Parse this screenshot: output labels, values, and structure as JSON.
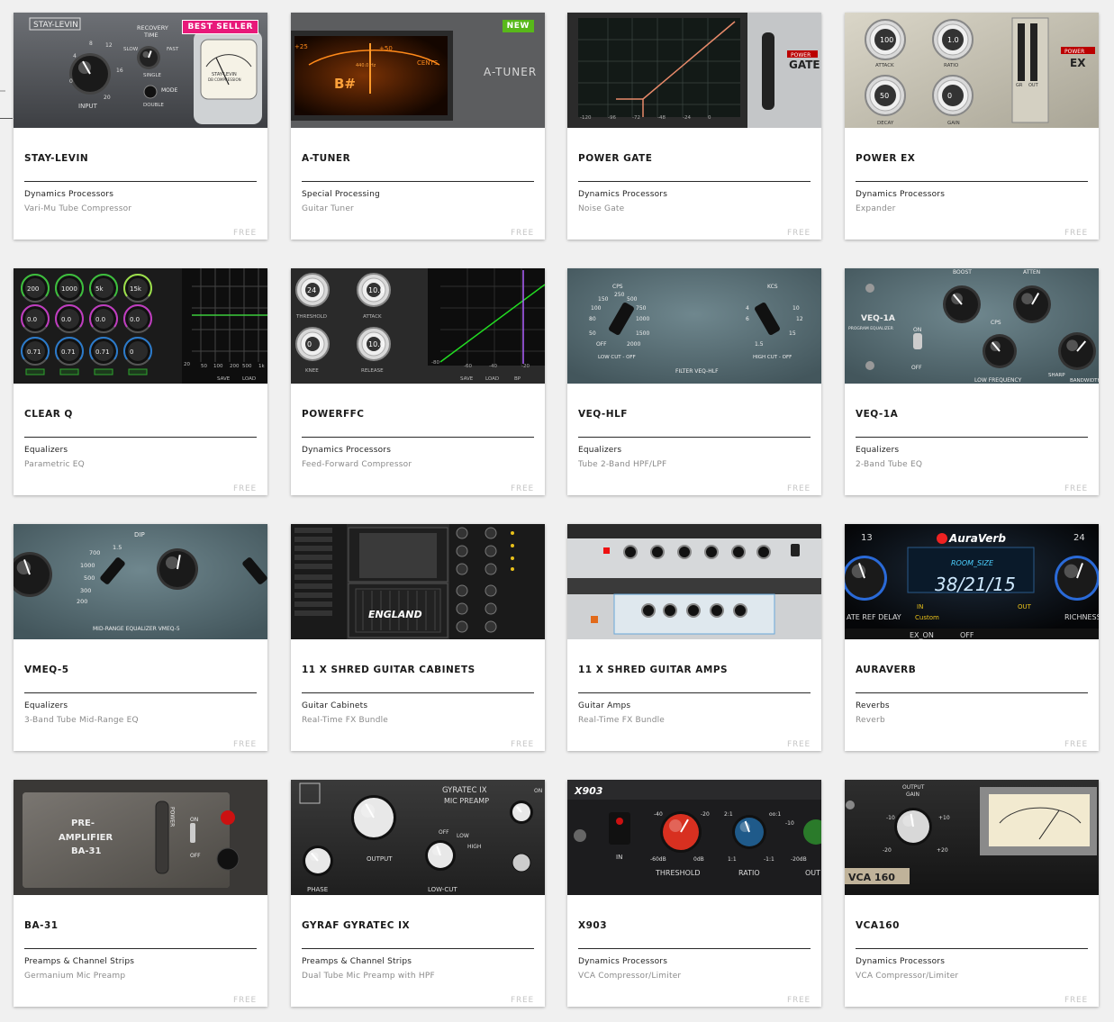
{
  "colors": {
    "best_seller": "#e8197a",
    "new": "#58b81a",
    "title": "#1a1a1a",
    "category": "#222222",
    "subtitle": "#8a8a8a",
    "price": "#c6c6c6"
  },
  "products": [
    {
      "title": "STAY-LEVIN",
      "category": "Dynamics Processors",
      "subtitle": "Vari-Mu Tube Compressor",
      "price": "FREE",
      "badge": "BEST SELLER",
      "thumb_text": [
        "STAY-LEVIN",
        "RECOVERY",
        "TIME",
        "SLOW",
        "FAST",
        "SINGLE",
        "MODE",
        "DOUBLE",
        "INPUT",
        "STAY-LEVIN",
        "DB COMPRESSION",
        "0",
        "4",
        "8",
        "12",
        "16",
        "20"
      ]
    },
    {
      "title": "A-TUNER",
      "category": "Special Processing",
      "subtitle": "Guitar Tuner",
      "price": "FREE",
      "badge": "NEW",
      "thumb_text": [
        "A-TUNER",
        "B#",
        "440.0 Hz",
        "25",
        "+25",
        "+50",
        "CENTS"
      ]
    },
    {
      "title": "POWER GATE",
      "category": "Dynamics Processors",
      "subtitle": "Noise Gate",
      "price": "FREE",
      "badge": "",
      "thumb_text": [
        "POWER",
        "GATE",
        "-120",
        "-96",
        "-72",
        "-48",
        "-24",
        "0"
      ]
    },
    {
      "title": "POWER EX",
      "category": "Dynamics Processors",
      "subtitle": "Expander",
      "price": "FREE",
      "badge": "",
      "thumb_text": [
        "100",
        "1.0",
        "50",
        "0",
        "ATTACK",
        "RATIO",
        "DECAY",
        "GAIN",
        "GR",
        "OUT",
        "POWER",
        "EX"
      ]
    },
    {
      "title": "CLEAR Q",
      "category": "Equalizers",
      "subtitle": "Parametric EQ",
      "price": "FREE",
      "badge": "",
      "thumb_text": [
        "200",
        "1000",
        "5k",
        "15k",
        "0.0",
        "0.0",
        "0.0",
        "0.0",
        "0.71",
        "0.71",
        "0.71",
        "0",
        "20",
        "50",
        "100",
        "200",
        "500",
        "1k",
        "SAVE",
        "LOAD"
      ]
    },
    {
      "title": "POWERFFC",
      "category": "Dynamics Processors",
      "subtitle": "Feed-Forward Compressor",
      "price": "FREE",
      "badge": "",
      "thumb_text": [
        "24",
        "10.0",
        "0",
        "10.0",
        "THRESHOLD",
        "ATTACK",
        "KNEE",
        "RELEASE",
        "-80",
        "-60",
        "-40",
        "-20",
        "SAVE",
        "LOAD",
        "BP"
      ]
    },
    {
      "title": "VEQ-HLF",
      "category": "Equalizers",
      "subtitle": "Tube 2-Band HPF/LPF",
      "price": "FREE",
      "badge": "",
      "thumb_text": [
        "CPS",
        "250",
        "500",
        "750",
        "1000",
        "1500",
        "2000",
        "150",
        "100",
        "80",
        "50",
        "OFF",
        "LOW CUT - OFF",
        "KCS",
        "4",
        "6",
        "8",
        "10",
        "12",
        "15",
        "1.5",
        "HIGH CUT - OFF",
        "FILTER VEQ-HLF"
      ]
    },
    {
      "title": "VEQ-1A",
      "category": "Equalizers",
      "subtitle": "2-Band Tube EQ",
      "price": "FREE",
      "badge": "",
      "thumb_text": [
        "VEQ-1A",
        "PROGRAM EQUALIZER",
        "ON",
        "OFF",
        "BOOST",
        "ATTEN",
        "CPS",
        "LOW FREQUENCY",
        "SHARP",
        "BANDWIDTH"
      ]
    },
    {
      "title": "VMEQ-5",
      "category": "Equalizers",
      "subtitle": "3-Band Tube Mid-Range EQ",
      "price": "FREE",
      "badge": "",
      "thumb_text": [
        "DIP",
        "700",
        "1.5",
        "1000",
        "500",
        "300",
        "200",
        "MID-RANGE EQUALIZER VMEQ-5"
      ]
    },
    {
      "title": "11 X SHRED GUITAR CABINETS",
      "category": "Guitar Cabinets",
      "subtitle": "Real-Time FX Bundle",
      "price": "FREE",
      "badge": "",
      "thumb_text": [
        "ENGLAND"
      ]
    },
    {
      "title": "11 X SHRED GUITAR AMPS",
      "category": "Guitar Amps",
      "subtitle": "Real-Time FX Bundle",
      "price": "FREE",
      "badge": "",
      "thumb_text": []
    },
    {
      "title": "AURAVERB",
      "category": "Reverbs",
      "subtitle": "Reverb",
      "price": "FREE",
      "badge": "",
      "thumb_text": [
        "AuraVerb",
        "ROOM_SIZE",
        "38/21/15",
        "IN",
        "OUT",
        "Custom",
        "ATE REF DELAY",
        "RICHNESS",
        "EX_ON",
        "OFF",
        "13",
        "24"
      ]
    },
    {
      "title": "BA-31",
      "category": "Preamps & Channel Strips",
      "subtitle": "Germanium Mic Preamp",
      "price": "FREE",
      "badge": "",
      "thumb_text": [
        "PRE-",
        "AMPLIFIER",
        "BA-31",
        "POWER",
        "ON",
        "OFF"
      ]
    },
    {
      "title": "GYRAF GYRATEC IX",
      "category": "Preamps & Channel Strips",
      "subtitle": "Dual Tube Mic Preamp with HPF",
      "price": "FREE",
      "badge": "",
      "thumb_text": [
        "GYRATEC IX",
        "MIC PREAMP",
        "OUTPUT",
        "PHASE",
        "LOW-CUT",
        "OFF",
        "LOW",
        "HIGH",
        "ON"
      ]
    },
    {
      "title": "X903",
      "category": "Dynamics Processors",
      "subtitle": "VCA Compressor/Limiter",
      "price": "FREE",
      "badge": "",
      "thumb_text": [
        "X903",
        "IN",
        "-40",
        "-20",
        "-60dB",
        "0dB",
        "THRESHOLD",
        "2:1",
        "oo:1",
        "1:1",
        "-1:1",
        "RATIO",
        "-10",
        "-20dB",
        "OUT"
      ]
    },
    {
      "title": "VCA160",
      "category": "Dynamics Processors",
      "subtitle": "VCA Compressor/Limiter",
      "price": "FREE",
      "badge": "",
      "thumb_text": [
        "OUTPUT",
        "GAIN",
        "-10",
        "+10",
        "-20",
        "+20",
        "VCA 160"
      ]
    }
  ]
}
